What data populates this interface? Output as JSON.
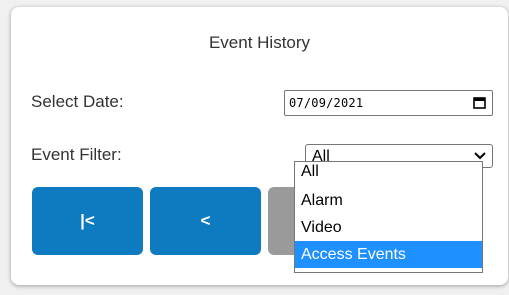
{
  "panel": {
    "title": "Event History"
  },
  "date_field": {
    "label": "Select Date:",
    "value": "07/09/2021",
    "icon": "calendar-icon"
  },
  "filter_field": {
    "label": "Event Filter:",
    "selected": "All",
    "options": [
      "All",
      "Alarm",
      "Video",
      "Access Events"
    ],
    "highlighted": "Access Events"
  },
  "nav_buttons": {
    "first_label": "|<",
    "prev_label": "<"
  },
  "colors": {
    "button_blue": "#0e7bc0",
    "highlight_blue": "#1e90ff",
    "button_disabled": "#9a9a9a"
  }
}
